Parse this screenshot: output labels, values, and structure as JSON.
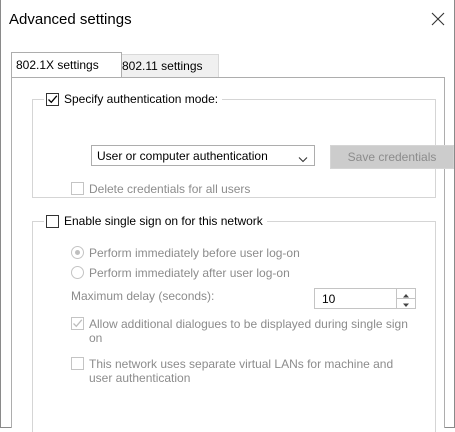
{
  "window": {
    "title": "Advanced settings"
  },
  "tabs": [
    {
      "label": "802.1X settings",
      "active": true
    },
    {
      "label": "802.11 settings",
      "active": false
    }
  ],
  "auth_group": {
    "specify_label": "Specify authentication mode:",
    "specify_checked": true,
    "mode_value": "User or computer authentication",
    "save_label": "Save credentials",
    "delete_label": "Delete credentials for all users",
    "delete_checked": false
  },
  "sso_group": {
    "enable_label": "Enable single sign on for this network",
    "enable_checked": false,
    "before_label": "Perform immediately before user log-on",
    "before_selected": true,
    "after_label": "Perform immediately after user log-on",
    "after_selected": false,
    "delay_label": "Maximum delay (seconds):",
    "delay_value": "10",
    "allow_label": "Allow additional dialogues to be displayed during single sign on",
    "allow_checked": true,
    "vlan_label": "This network uses separate virtual LANs for machine and user authentication",
    "vlan_checked": false
  },
  "colors": {
    "disabled_text": "#8c8c8c",
    "border": "#adadad",
    "button_disabled": "#cccccc"
  }
}
